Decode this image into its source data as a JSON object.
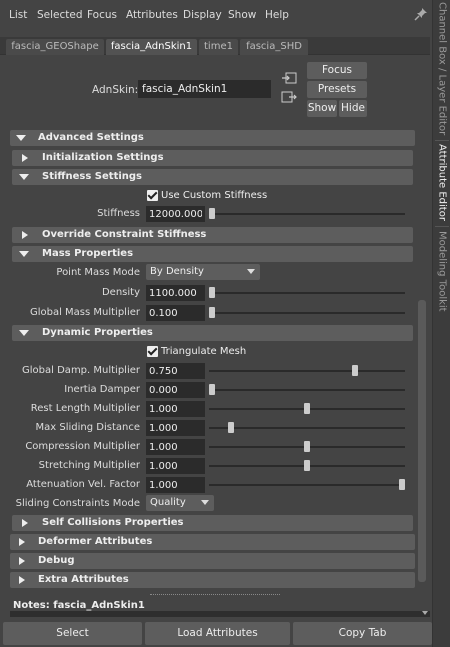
{
  "menu": [
    "List",
    "Selected",
    "Focus",
    "Attributes",
    "Display",
    "Show",
    "Help"
  ],
  "tabs": [
    {
      "label": "fascia_GEOShape",
      "active": false
    },
    {
      "label": "fascia_AdnSkin1",
      "active": true
    },
    {
      "label": "time1",
      "active": false
    },
    {
      "label": "fascia_SHD",
      "active": false
    }
  ],
  "side_tabs": [
    {
      "label": "Channel Box / Layer Editor",
      "active": false
    },
    {
      "label": "Attribute Editor",
      "active": true
    },
    {
      "label": "Modeling Toolkit",
      "active": false
    }
  ],
  "header": {
    "label": "AdnSkin:",
    "value": "fascia_AdnSkin1",
    "buttons": {
      "focus": "Focus",
      "presets": "Presets",
      "show": "Show",
      "hide": "Hide"
    }
  },
  "sections": {
    "advanced": "Advanced Settings",
    "initialization": "Initialization Settings",
    "stiffness": "Stiffness Settings",
    "override": "Override Constraint Stiffness",
    "mass": "Mass Properties",
    "dynamic": "Dynamic Properties",
    "self_collisions": "Self Collisions Properties",
    "deformer": "Deformer Attributes",
    "debug": "Debug",
    "extra": "Extra Attributes"
  },
  "stiffness": {
    "use_custom_label": "Use Custom Stiffness",
    "use_custom_checked": true,
    "stiffness_label": "Stiffness",
    "stiffness_value": "12000.000",
    "stiffness_slider": 0.0
  },
  "mass": {
    "point_mass_mode_label": "Point Mass Mode",
    "point_mass_mode_value": "By Density",
    "density_label": "Density",
    "density_value": "1100.000",
    "density_slider": 0.0,
    "global_mass_label": "Global Mass Multiplier",
    "global_mass_value": "0.100",
    "global_mass_slider": 0.0
  },
  "dynamic": {
    "triangulate_label": "Triangulate Mesh",
    "triangulate_checked": true,
    "rows": [
      {
        "label": "Global Damp. Multiplier",
        "value": "0.750",
        "slider": 0.75
      },
      {
        "label": "Inertia Damper",
        "value": "0.000",
        "slider": 0.0
      },
      {
        "label": "Rest Length Multiplier",
        "value": "1.000",
        "slider": 0.5
      },
      {
        "label": "Max Sliding Distance",
        "value": "1.000",
        "slider": 0.1
      },
      {
        "label": "Compression Multiplier",
        "value": "1.000",
        "slider": 0.5
      },
      {
        "label": "Stretching Multiplier",
        "value": "1.000",
        "slider": 0.5
      },
      {
        "label": "Attenuation Vel. Factor",
        "value": "1.000",
        "slider": 1.0
      }
    ],
    "sliding_mode_label": "Sliding Constraints Mode",
    "sliding_mode_value": "Quality"
  },
  "notes": {
    "label": "Notes:",
    "node": "fascia_AdnSkin1"
  },
  "bottom_buttons": {
    "select": "Select",
    "load": "Load Attributes",
    "copy": "Copy Tab"
  }
}
